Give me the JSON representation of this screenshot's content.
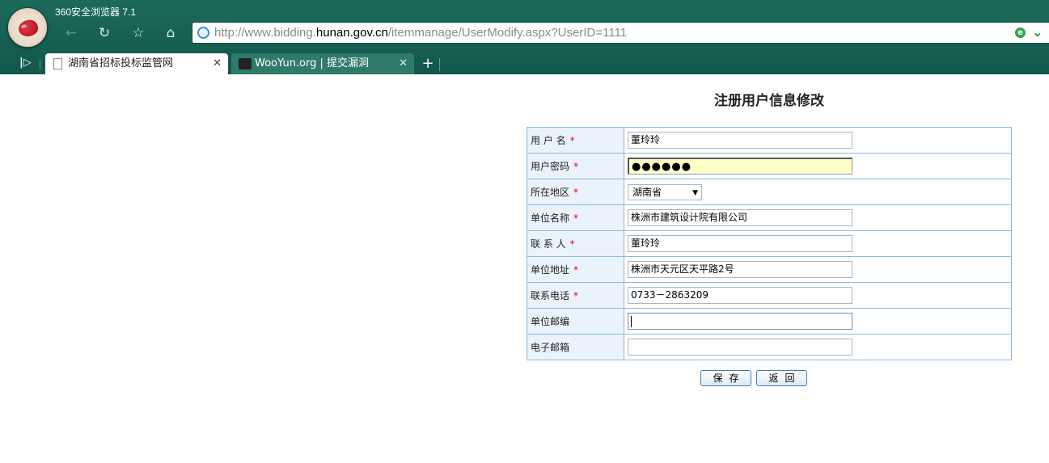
{
  "browser": {
    "app_title": "360安全浏览器 7.1",
    "url_prefix": "http://www.bidding.",
    "url_host": "hunan.gov.cn",
    "url_path": "/itemmanage/UserModify.aspx?UserID=1111",
    "tabs": [
      {
        "label": "湖南省招标投标监管网",
        "active": true
      },
      {
        "label": "WooYun.org | 提交漏洞",
        "active": false
      }
    ],
    "accent_color": "#1c6a5a"
  },
  "page": {
    "title": "注册用户信息修改",
    "fields": [
      {
        "label": "用 户 名",
        "required": true,
        "value": "董玲玲",
        "type": "text"
      },
      {
        "label": "用户密码",
        "required": true,
        "value": "●●●●●●",
        "type": "password"
      },
      {
        "label": "所在地区",
        "required": true,
        "value": "湖南省",
        "type": "select"
      },
      {
        "label": "单位名称",
        "required": true,
        "value": "株洲市建筑设计院有限公司",
        "type": "text"
      },
      {
        "label": "联 系 人",
        "required": true,
        "value": "董玲玲",
        "type": "text"
      },
      {
        "label": "单位地址",
        "required": true,
        "value": "株洲市天元区天平路2号",
        "type": "text"
      },
      {
        "label": "联系电话",
        "required": true,
        "value": "0733－2863209",
        "type": "text"
      },
      {
        "label": "单位邮编",
        "required": false,
        "value": "",
        "type": "text"
      },
      {
        "label": "电子邮箱",
        "required": false,
        "value": "",
        "type": "text"
      }
    ],
    "required_mark": "*",
    "save_label": "保存",
    "back_label": "返回"
  }
}
